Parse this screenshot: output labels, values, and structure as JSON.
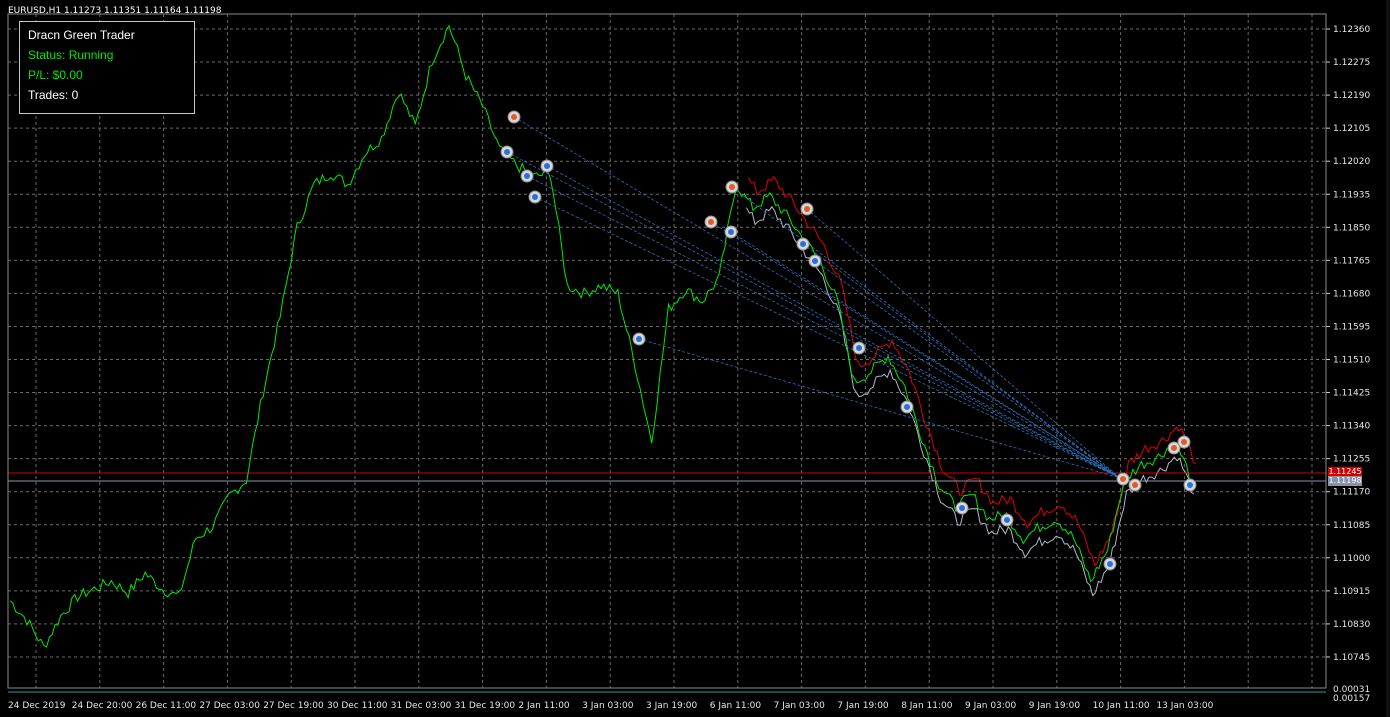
{
  "symbol_header": "EURUSD,H1  1.11273 1.11351 1.11164 1.11198",
  "panel": {
    "title": "Dracn Green Trader",
    "status": "Status: Running",
    "pl": "P/L: $0.00",
    "trades": "Trades: 0"
  },
  "price_axis": [
    "1.12360",
    "1.12275",
    "1.12190",
    "1.12105",
    "1.12020",
    "1.11935",
    "1.11850",
    "1.11765",
    "1.11680",
    "1.11595",
    "1.11510",
    "1.11425",
    "1.11340",
    "1.11255",
    "1.11170",
    "1.11085",
    "1.11000",
    "1.10915",
    "1.10830",
    "1.10745",
    "0.00031",
    "0.00157"
  ],
  "price_tags": {
    "red": "1.11245",
    "gray": "1.11198"
  },
  "time_axis": [
    "24 Dec 2019",
    "24 Dec 20:00",
    "26 Dec 11:00",
    "27 Dec 03:00",
    "27 Dec 19:00",
    "30 Dec 11:00",
    "31 Dec 03:00",
    "31 Dec 19:00",
    "2 Jan 11:00",
    "3 Jan 03:00",
    "3 Jan 19:00",
    "6 Jan 11:00",
    "7 Jan 03:00",
    "7 Jan 19:00",
    "8 Jan 11:00",
    "9 Jan 03:00",
    "9 Jan 19:00",
    "10 Jan 11:00",
    "13 Jan 03:00"
  ],
  "colors": {
    "price_line": "#00e800",
    "upper_band": "#e00000",
    "lower_band": "#b0b8c8",
    "grid": "#6a6a6a"
  },
  "chart_data": {
    "type": "line",
    "price_line": [
      1.1089,
      1.1084,
      1.1077,
      1.1085,
      1.109,
      1.1092,
      1.1094,
      1.1091,
      1.1096,
      1.1092,
      1.109,
      1.1105,
      1.1108,
      1.1116,
      1.112,
      1.1143,
      1.1162,
      1.1185,
      1.1196,
      1.1199,
      1.1196,
      1.1204,
      1.1208,
      1.122,
      1.1211,
      1.1228,
      1.1237,
      1.1224,
      1.1216,
      1.1205,
      1.1201,
      1.1198,
      1.1199,
      1.117,
      1.1168,
      1.117,
      1.1168,
      1.115,
      1.113,
      1.1164,
      1.1169,
      1.1166,
      1.1172,
      1.1196,
      1.119,
      1.1193,
      1.1188,
      1.1182,
      1.1176,
      1.1166,
      1.1145,
      1.1148,
      1.1152,
      1.1144,
      1.1131,
      1.1119,
      1.1113,
      1.1116,
      1.111,
      1.1111,
      1.1105,
      1.1108,
      1.111,
      1.1105,
      1.1094,
      1.1102,
      1.112,
      1.1124,
      1.1126,
      1.113,
      1.112
    ]
  }
}
